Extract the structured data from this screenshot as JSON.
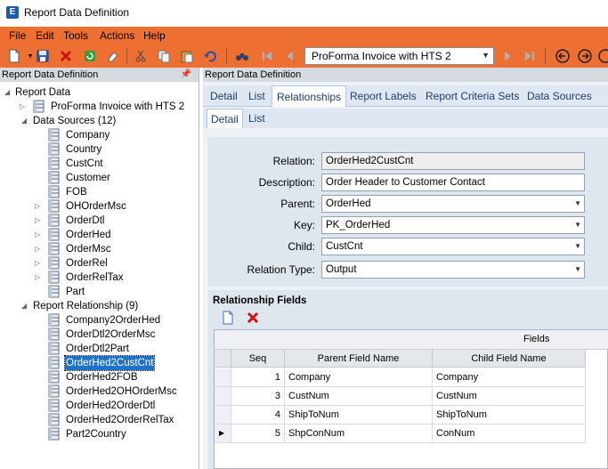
{
  "window": {
    "title": "Report Data Definition",
    "app_icon": "E"
  },
  "menu": [
    "File",
    "Edit",
    "Tools",
    "Actions",
    "Help"
  ],
  "toolbar": {
    "report_selected": "ProForma Invoice with HTS 2"
  },
  "left_panel": {
    "header": "Report Data Definition",
    "tree": {
      "root": "Report Data",
      "report": "ProForma Invoice with HTS 2",
      "data_sources_label": "Data Sources (12)",
      "data_sources": [
        {
          "label": "Company",
          "expandable": false
        },
        {
          "label": "Country",
          "expandable": false
        },
        {
          "label": "CustCnt",
          "expandable": false
        },
        {
          "label": "Customer",
          "expandable": false
        },
        {
          "label": "FOB",
          "expandable": false
        },
        {
          "label": "OHOrderMsc",
          "expandable": true
        },
        {
          "label": "OrderDtl",
          "expandable": true
        },
        {
          "label": "OrderHed",
          "expandable": true
        },
        {
          "label": "OrderMsc",
          "expandable": true
        },
        {
          "label": "OrderRel",
          "expandable": true
        },
        {
          "label": "OrderRelTax",
          "expandable": true
        },
        {
          "label": "Part",
          "expandable": false
        }
      ],
      "relationships_label": "Report Relationship (9)",
      "relationships": [
        {
          "label": "Company2OrderHed",
          "selected": false
        },
        {
          "label": "OrderDtl2OrderMsc",
          "selected": false
        },
        {
          "label": "OrderDtl2Part",
          "selected": false
        },
        {
          "label": "OrderHed2CustCnt",
          "selected": true
        },
        {
          "label": "OrderHed2FOB",
          "selected": false
        },
        {
          "label": "OrderHed2OHOrderMsc",
          "selected": false
        },
        {
          "label": "OrderHed2OrderDtl",
          "selected": false
        },
        {
          "label": "OrderHed2OrderRelTax",
          "selected": false
        },
        {
          "label": "Part2Country",
          "selected": false
        }
      ]
    }
  },
  "right_panel": {
    "header": "Report Data Definition",
    "tabs": [
      "Detail",
      "List",
      "Relationships",
      "Report Labels",
      "Report Criteria Sets",
      "Data Sources"
    ],
    "active_tab": "Relationships",
    "subtabs": [
      "Detail",
      "List"
    ],
    "active_subtab": "Detail",
    "form": {
      "relation_label": "Relation:",
      "relation_value": "OrderHed2CustCnt",
      "description_label": "Description:",
      "description_value": "Order Header to Customer Contact",
      "parent_label": "Parent:",
      "parent_value": "OrderHed",
      "key_label": "Key:",
      "key_value": "PK_OrderHed",
      "child_label": "Child:",
      "child_value": "CustCnt",
      "relation_type_label": "Relation Type:",
      "relation_type_value": "Output"
    },
    "fields": {
      "title": "Relationship Fields",
      "group_label": "Fields",
      "columns": [
        "Seq",
        "Parent Field Name",
        "Child Field Name"
      ],
      "rows": [
        {
          "seq": "1",
          "parent": "Company",
          "child": "Company",
          "current": false
        },
        {
          "seq": "3",
          "parent": "CustNum",
          "child": "CustNum",
          "current": false
        },
        {
          "seq": "4",
          "parent": "ShipToNum",
          "child": "ShipToNum",
          "current": false
        },
        {
          "seq": "5",
          "parent": "ShpConNum",
          "child": "ConNum",
          "current": true
        }
      ]
    }
  }
}
